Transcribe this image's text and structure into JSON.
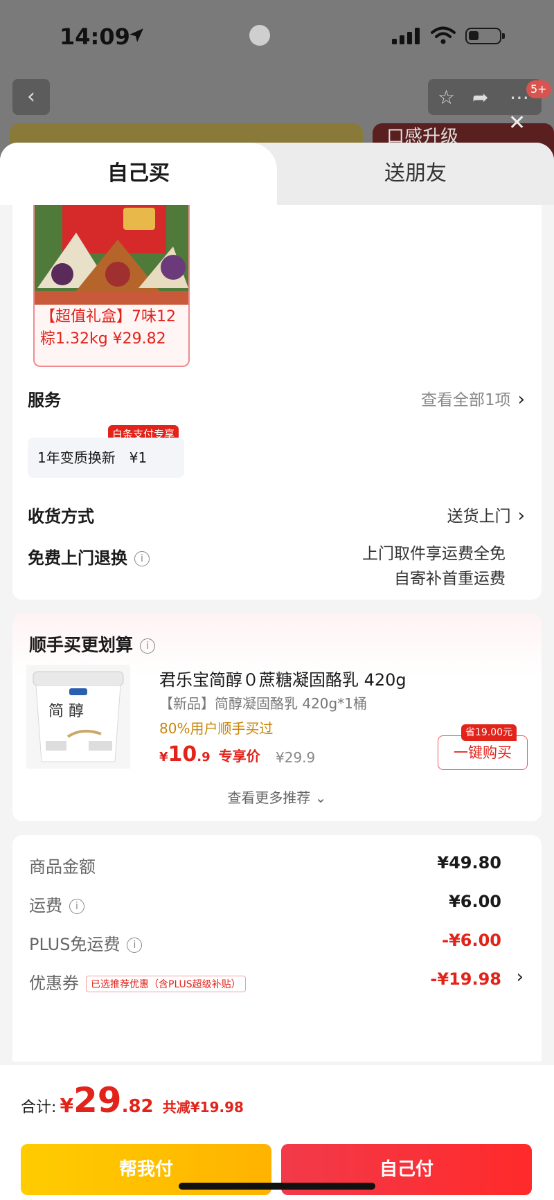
{
  "status_bar": {
    "time": "14:09"
  },
  "background": {
    "badge": "5+",
    "banner2_text": "口感升级"
  },
  "tabs": [
    {
      "label": "自己买"
    },
    {
      "label": "送朋友"
    }
  ],
  "selected_product": {
    "caption": "【超值礼盒】7味12粽1.32kg ¥29.82"
  },
  "service": {
    "label": "服务",
    "view_all": "查看全部1项",
    "option_badge": "白条支付专享",
    "option_name": "1年变质换新",
    "option_price": "¥1"
  },
  "delivery": {
    "label": "收货方式",
    "value": "送货上门"
  },
  "return": {
    "label": "免费上门退换",
    "line1": "上门取件享运费全免",
    "line2": "自寄补首重运费"
  },
  "addon": {
    "title": "顺手买更划算",
    "product_name": "君乐宝简醇０蔗糖凝固酪乳 420g",
    "product_sub": "【新品】简醇凝固酪乳 420g*1桶",
    "buyers_text": "80%用户顺手买过",
    "price_symbol": "¥",
    "price_int": "10",
    "price_dec": ".9",
    "price_tag": "专享价",
    "old_price": "¥29.9",
    "save_badge": "省19.00元",
    "buy_button": "一键购买",
    "more": "查看更多推荐"
  },
  "fees": {
    "goods_label": "商品金额",
    "goods_value": "¥49.80",
    "shipping_label": "运费",
    "shipping_value": "¥6.00",
    "plus_label": "PLUS免运费",
    "plus_value": "-¥6.00",
    "coupon_label": "优惠券",
    "coupon_tag": "已选推荐优惠（含PLUS超级补贴）",
    "coupon_value": "-¥19.98"
  },
  "footer": {
    "total_label": "合计:",
    "currency": "¥",
    "total_int": "29",
    "total_dec": ".82",
    "discount": "共减¥19.98",
    "help_pay": "帮我付",
    "self_pay": "自己付"
  },
  "colors": {
    "accent_red": "#e2231a",
    "help_yellow": "#ffc000",
    "buyers_orange": "#c8860a"
  }
}
